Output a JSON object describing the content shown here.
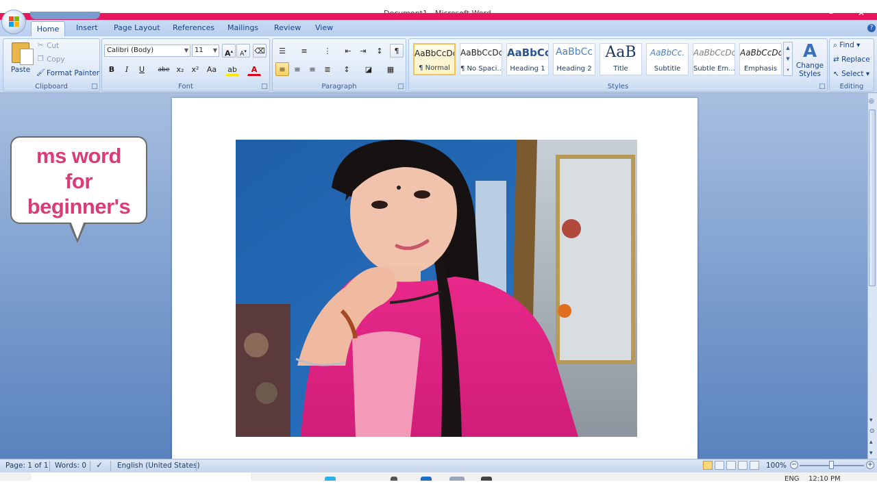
{
  "window": {
    "title": "Document1 - Microsoft Word"
  },
  "tabs": [
    {
      "label": "Home"
    },
    {
      "label": "Insert"
    },
    {
      "label": "Page Layout"
    },
    {
      "label": "References"
    },
    {
      "label": "Mailings"
    },
    {
      "label": "Review"
    },
    {
      "label": "View"
    }
  ],
  "clipboard": {
    "paste": "Paste",
    "cut": "Cut",
    "copy": "Copy",
    "format_painter": "Format Painter",
    "label": "Clipboard"
  },
  "font": {
    "name": "Calibri (Body)",
    "size": "11",
    "label": "Font",
    "bold": "B",
    "italic": "I",
    "underline": "U",
    "strike": "abe",
    "subscript": "x₂",
    "superscript": "x²",
    "change_case": "Aa"
  },
  "paragraph": {
    "label": "Paragraph",
    "show_marks": "¶"
  },
  "styles": {
    "label": "Styles",
    "items": [
      {
        "preview": "AaBbCcDc",
        "name": "¶ Normal"
      },
      {
        "preview": "AaBbCcDc",
        "name": "¶ No Spaci..."
      },
      {
        "preview": "AaBbCc",
        "name": "Heading 1"
      },
      {
        "preview": "AaBbCc",
        "name": "Heading 2"
      },
      {
        "preview": "AaB",
        "name": "Title"
      },
      {
        "preview": "AaBbCc.",
        "name": "Subtitle"
      },
      {
        "preview": "AaBbCcDc",
        "name": "Subtle Em..."
      },
      {
        "preview": "AaBbCcDc",
        "name": "Emphasis"
      }
    ],
    "change_styles": "Change Styles"
  },
  "editing": {
    "label": "Editing",
    "find": "Find",
    "replace": "Replace",
    "select": "Select"
  },
  "overlay": {
    "line1": "ms word",
    "line2": "for",
    "line3": "beginner's"
  },
  "status": {
    "page": "Page: 1 of 1",
    "words": "Words: 0",
    "language": "English (United States)",
    "zoom": "100%"
  },
  "taskbar": {
    "lang": "ENG",
    "time": "12:10 PM"
  },
  "colors": {
    "accent": "#e8175d",
    "ribbon": "#d5e3f6",
    "bubble_text": "#d93c78",
    "workspace": "#7e9fcf"
  }
}
